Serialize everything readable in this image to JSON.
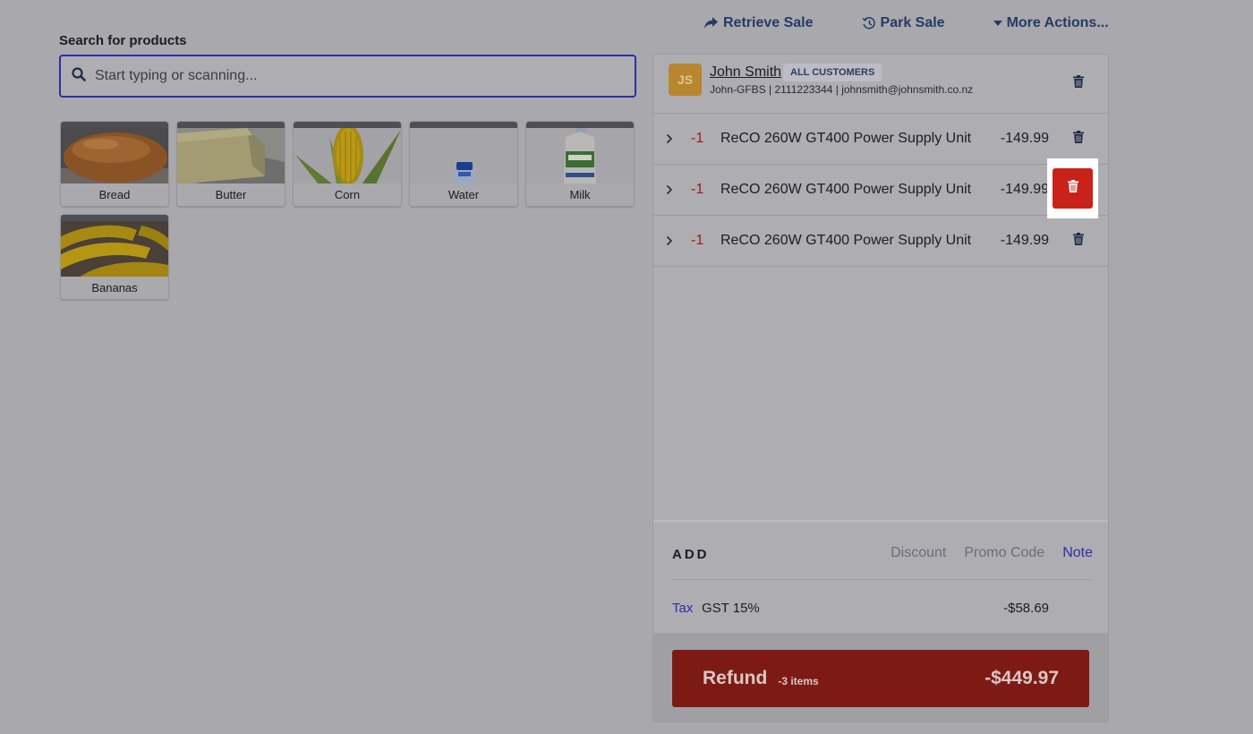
{
  "top_actions": {
    "retrieve_sale": "Retrieve Sale",
    "park_sale": "Park Sale",
    "more_actions": "More Actions..."
  },
  "search": {
    "label": "Search for products",
    "placeholder": "Start typing or scanning...",
    "value": ""
  },
  "products": [
    {
      "name": "Bread"
    },
    {
      "name": "Butter"
    },
    {
      "name": "Corn"
    },
    {
      "name": "Water"
    },
    {
      "name": "Milk"
    },
    {
      "name": "Bananas"
    }
  ],
  "customer": {
    "initials": "JS",
    "name": "John Smith",
    "group": "ALL CUSTOMERS",
    "details": "John-GFBS | 2111223344 | johnsmith@johnsmith.co.nz"
  },
  "line_items": [
    {
      "qty": "-1",
      "name": "ReCO 260W GT400 Power Supply Unit",
      "price": "-149.99"
    },
    {
      "qty": "-1",
      "name": "ReCO 260W GT400 Power Supply Unit",
      "price": "-149.99"
    },
    {
      "qty": "-1",
      "name": "ReCO 260W GT400 Power Supply Unit",
      "price": "-149.99"
    }
  ],
  "add": {
    "label": "ADD",
    "discount": "Discount",
    "promo_code": "Promo Code",
    "note": "Note"
  },
  "tax": {
    "link": "Tax",
    "rate": "GST 15%",
    "amount": "-$58.69"
  },
  "refund": {
    "label": "Refund",
    "count": "-3 items",
    "total": "-$449.97"
  },
  "colors": {
    "accent": "#2d2fa6",
    "delete_highlight": "#c8221a",
    "refund": "#7e1a14",
    "navy": "#243b67"
  }
}
